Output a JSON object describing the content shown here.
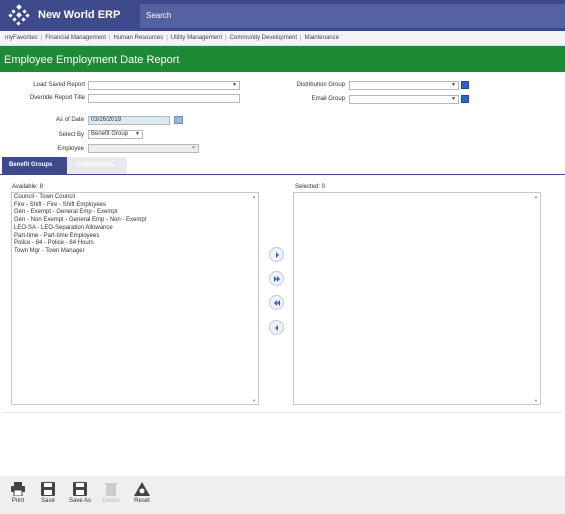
{
  "app": {
    "title": "New World ERP",
    "search_label": "Search"
  },
  "nav": {
    "items": [
      "myFavorites",
      "Financial Management",
      "Human Resources",
      "Utility Management",
      "Community Development",
      "Maintenance"
    ],
    "separator": "|"
  },
  "page": {
    "title": "Employee Employment Date Report"
  },
  "form": {
    "load_saved_report_label": "Load Saved Report",
    "load_saved_report_value": "",
    "override_title_label": "Override Report Title",
    "override_title_value": "",
    "distribution_group_label": "Distribution Group",
    "distribution_group_value": "",
    "email_group_label": "Email Group",
    "email_group_value": "",
    "as_of_date_label": "As of Date",
    "as_of_date_value": "03/26/2019",
    "select_by_label": "Select By",
    "select_by_value": "Benefit Group",
    "employee_label": "Employee",
    "employee_value": ""
  },
  "tabs": {
    "active": "Benefit Groups",
    "inactive": "Departments"
  },
  "available": {
    "label": "Available: 8",
    "items": [
      "Council - Town Council",
      "Fire - Shift - Fire - Shift Employees",
      "Gen - Exempt - General Emp - Exempt",
      "Gen - Non Exempt - General Emp - Non - Exempt",
      "LEO-SA - LEO-Separation Allowance",
      "Part-time - Part-time Employees",
      "Police - 84 - Police - 84 Hours",
      "Town Mgr - Town Manager"
    ]
  },
  "selected": {
    "label": "Selected: 0",
    "items": []
  },
  "toolbar": {
    "print": "Print",
    "save": "Save",
    "save_as": "Save As",
    "delete": "Delete",
    "reset": "Reset"
  },
  "colors": {
    "topbar": "#3f4a8c",
    "header": "#1d8a35",
    "tab_active": "#3f4a8c",
    "date_field": "#d9ebf9"
  }
}
